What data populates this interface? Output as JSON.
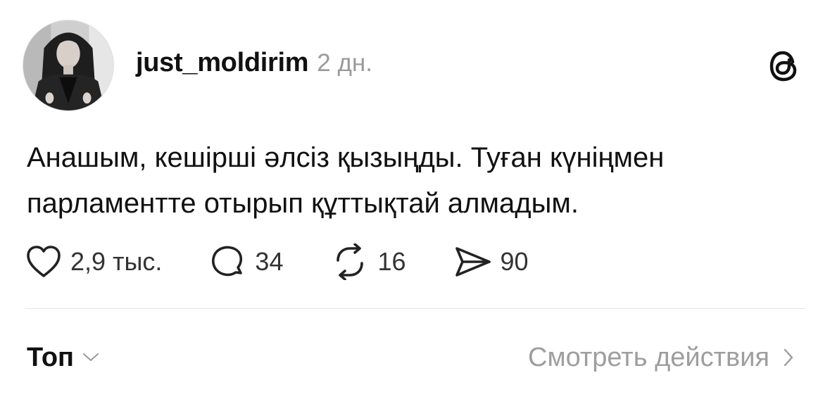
{
  "post": {
    "author": "just_moldirim",
    "time": "2 дн.",
    "text": "Анашым, кешірші әлсіз қызыңды. Туған күніңмен парламентте отырып құттықтай алмадым.",
    "avatar_icon": "profile-photo-avatar",
    "menu_icon": "threads-logo-icon"
  },
  "actions": {
    "likes": "2,9 тыс.",
    "replies": "34",
    "reposts": "16",
    "shares": "90"
  },
  "footer": {
    "sort_label": "Топ",
    "view_activity_label": "Смотреть действия"
  },
  "colors": {
    "text": "#111111",
    "muted": "#9a9a9a",
    "divider": "#e2e2e2"
  }
}
